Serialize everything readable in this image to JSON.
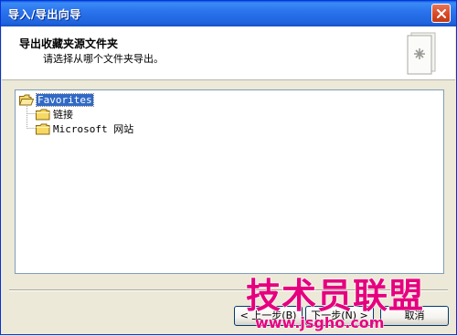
{
  "window": {
    "title": "导入/导出向导"
  },
  "header": {
    "title": "导出收藏夹源文件夹",
    "subtitle": "请选择从哪个文件夹导出。"
  },
  "tree": {
    "root": {
      "label": "Favorites",
      "selected": true
    },
    "children": [
      {
        "label": "链接"
      },
      {
        "label": "Microsoft 网站"
      }
    ]
  },
  "buttons": {
    "back": "< 上一步(B)",
    "next": "下一步(N) >",
    "cancel": "取消"
  },
  "watermark": {
    "text": "技术员联盟",
    "url": "www.jsgho.com"
  },
  "colors": {
    "title_bar": "#2A74EE",
    "selection": "#316AC5",
    "watermark": "#E6007E"
  }
}
